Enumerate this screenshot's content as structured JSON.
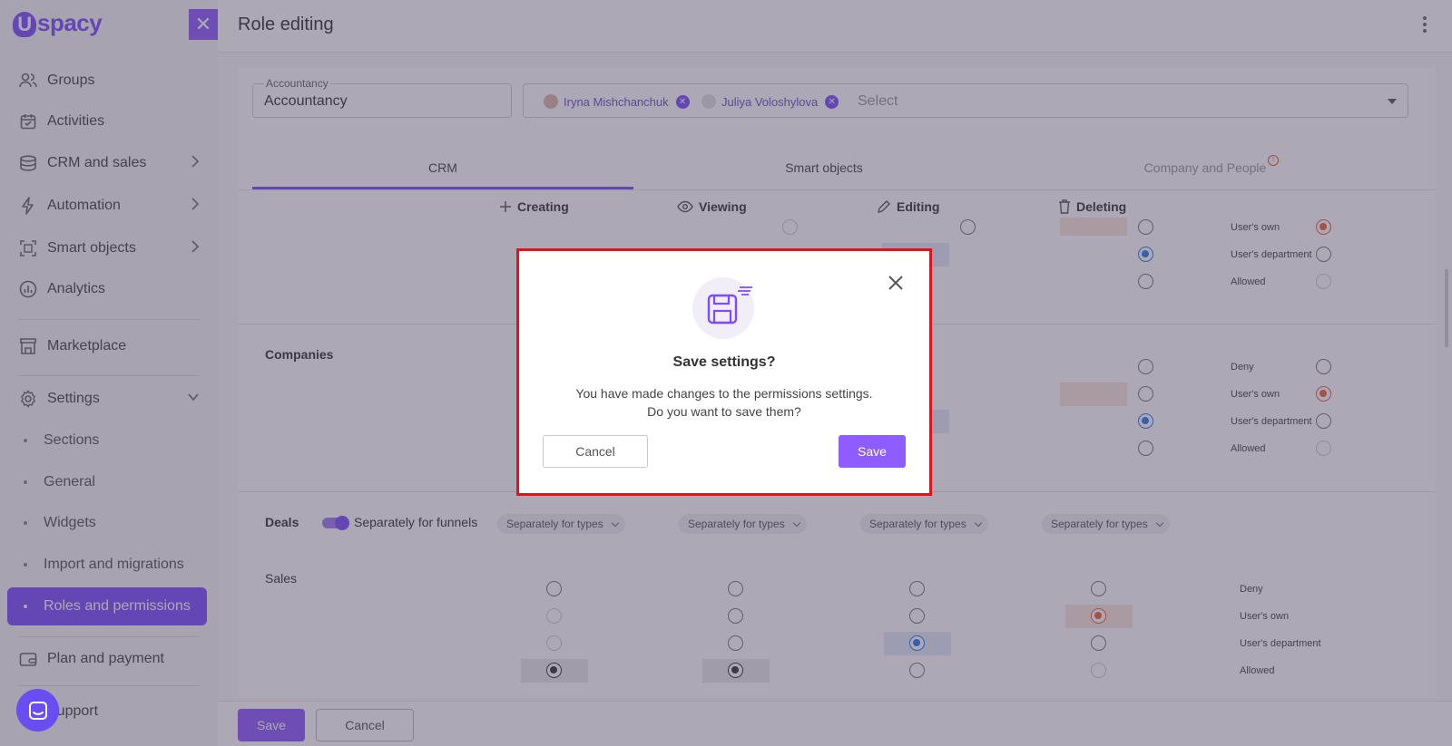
{
  "brand": {
    "logo_text": "spacy",
    "logo_letter": "U"
  },
  "sidebar": {
    "items": [
      {
        "label": "Groups",
        "icon": "users-icon"
      },
      {
        "label": "Activities",
        "icon": "calendar-icon"
      },
      {
        "label": "CRM and sales",
        "icon": "coins-icon"
      },
      {
        "label": "Automation",
        "icon": "lightning-icon"
      },
      {
        "label": "Smart objects",
        "icon": "scan-icon"
      },
      {
        "label": "Analytics",
        "icon": "chart-icon"
      },
      {
        "label": "Marketplace",
        "icon": "store-icon"
      },
      {
        "label": "Settings",
        "icon": "gear-icon"
      }
    ],
    "sub_items": [
      "Sections",
      "General",
      "Widgets",
      "Import and migrations",
      "Roles and permissions"
    ],
    "bottom_items": [
      {
        "label": "Plan and payment",
        "icon": "wallet-icon"
      },
      {
        "label": "Support",
        "icon": "support-icon"
      }
    ]
  },
  "header": {
    "title": "Role editing"
  },
  "role": {
    "name_label": "Accountancy",
    "name_value": "Accountancy"
  },
  "users": {
    "chips": [
      "Iryna Mishchanchuk",
      "Juliya Voloshylova"
    ],
    "placeholder": "Select"
  },
  "tabs": [
    "CRM",
    "Smart objects",
    "Company and People"
  ],
  "columns": [
    "Creating",
    "Viewing",
    "Editing",
    "Deleting"
  ],
  "levels": {
    "deny": "Deny",
    "own": "User's own",
    "department": "User's department",
    "allowed": "Allowed"
  },
  "sections": {
    "companies": "Companies",
    "deals": "Deals",
    "sales": "Sales"
  },
  "deals": {
    "toggle_label": "Separately for funnels",
    "type_dropdown": "Separately for types"
  },
  "footer": {
    "save": "Save",
    "cancel": "Cancel"
  },
  "modal": {
    "title": "Save settings?",
    "line1": "You have made changes to the permissions settings.",
    "line2": "Do you want to save them?",
    "cancel": "Cancel",
    "save": "Save"
  },
  "colors": {
    "accent": "#7c4dff",
    "modal_border": "#e5121c",
    "selected_blue": "#2b7de9",
    "selected_orange": "#e8663a"
  }
}
